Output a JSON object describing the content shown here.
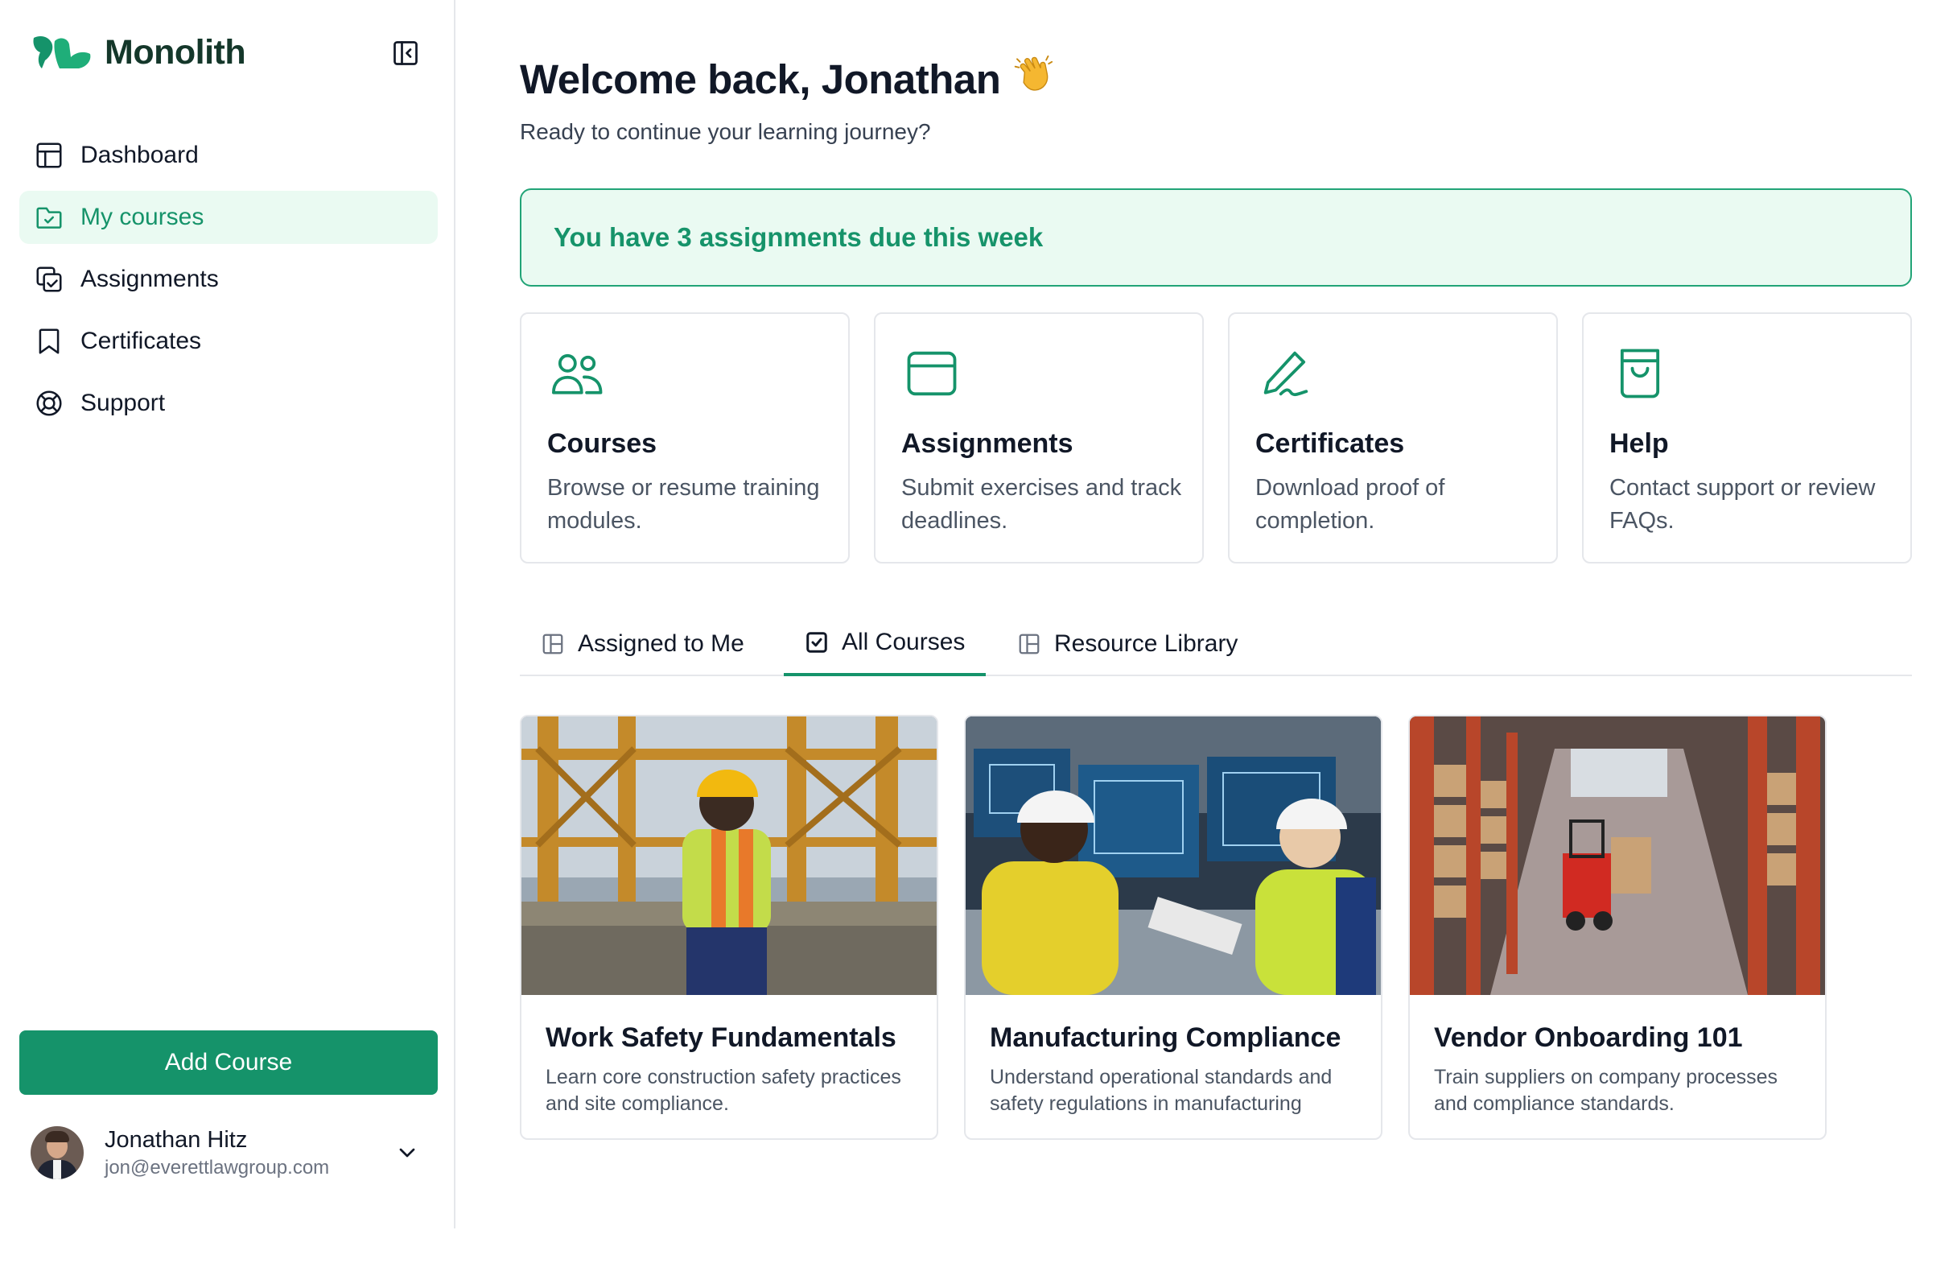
{
  "brand": {
    "name": "Monolith",
    "accent": "#15936a"
  },
  "sidebar": {
    "items": [
      {
        "label": "Dashboard",
        "icon": "layout-icon",
        "active": false
      },
      {
        "label": "My courses",
        "icon": "folder-check-icon",
        "active": true
      },
      {
        "label": "Assignments",
        "icon": "copy-check-icon",
        "active": false
      },
      {
        "label": "Certificates",
        "icon": "bookmark-icon",
        "active": false
      },
      {
        "label": "Support",
        "icon": "lifebuoy-icon",
        "active": false
      }
    ],
    "add_course_label": "Add Course",
    "user": {
      "name": "Jonathan Hitz",
      "email": "jon@everettlawgroup.com"
    }
  },
  "main": {
    "welcome": "Welcome back, Jonathan",
    "subtitle": "Ready to continue your learning journey?",
    "alert": "You have 3 assignments due this week",
    "quick_cards": [
      {
        "title": "Courses",
        "desc": "Browse or resume training modules.",
        "icon": "users-icon"
      },
      {
        "title": "Assignments",
        "desc": "Submit exercises and track deadlines.",
        "icon": "window-icon"
      },
      {
        "title": "Certificates",
        "desc": "Download proof of completion.",
        "icon": "signature-icon"
      },
      {
        "title": "Help",
        "desc": "Contact support or review FAQs.",
        "icon": "shopping-bag-icon"
      }
    ],
    "tabs": [
      {
        "label": "Assigned to Me",
        "icon": "layout-icon",
        "active": false
      },
      {
        "label": "All Courses",
        "icon": "checkbox-icon",
        "active": true
      },
      {
        "label": "Resource Library",
        "icon": "layout-icon",
        "active": false
      }
    ],
    "courses": [
      {
        "title": "Work Safety Fundamentals",
        "desc": "Learn core construction safety practices and site compliance."
      },
      {
        "title": "Manufacturing Compliance",
        "desc": "Understand operational standards and safety regulations in manufacturing"
      },
      {
        "title": "Vendor Onboarding 101",
        "desc": "Train suppliers on company processes and compliance standards."
      }
    ]
  }
}
